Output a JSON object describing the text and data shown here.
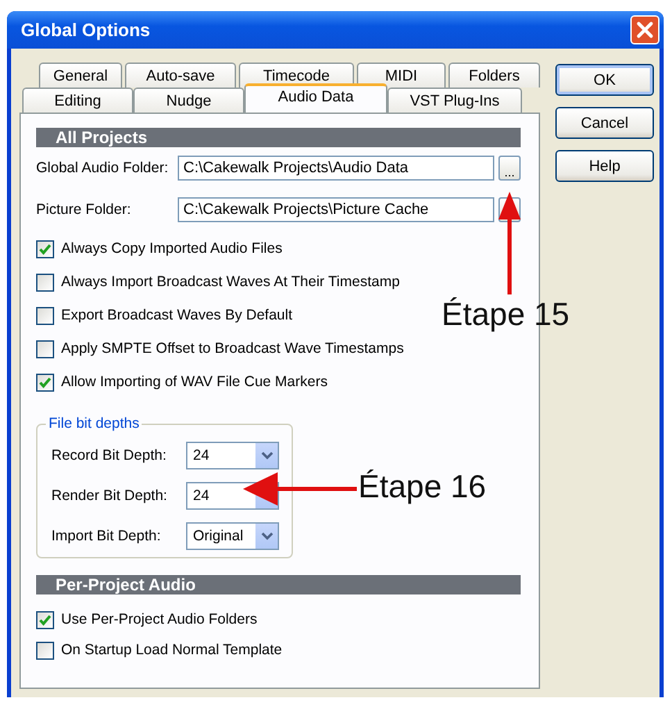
{
  "window": {
    "title": "Global Options"
  },
  "tab_rows": [
    {
      "tabs": [
        {
          "label": "General",
          "selected": false
        },
        {
          "label": "Auto-save",
          "selected": false
        },
        {
          "label": "Timecode",
          "selected": false
        },
        {
          "label": "MIDI",
          "selected": false
        },
        {
          "label": "Folders",
          "selected": false
        }
      ]
    },
    {
      "tabs": [
        {
          "label": "Editing",
          "selected": false
        },
        {
          "label": "Nudge",
          "selected": false
        },
        {
          "label": "Audio Data",
          "selected": true
        },
        {
          "label": "VST Plug-Ins",
          "selected": false
        }
      ]
    }
  ],
  "buttons": [
    {
      "label": "OK",
      "default": true
    },
    {
      "label": "Cancel",
      "default": false
    },
    {
      "label": "Help",
      "default": false
    }
  ],
  "sections": [
    {
      "title": "All Projects",
      "fields": [
        {
          "label": "Global Audio Folder:",
          "value": "C:\\Cakewalk Projects\\Audio Data",
          "button": "..."
        },
        {
          "label": "Picture Folder:",
          "value": "C:\\Cakewalk Projects\\Picture Cache"
        }
      ],
      "checkboxes": [
        {
          "label": "Always Copy Imported Audio Files",
          "checked": true
        },
        {
          "label": "Always Import Broadcast Waves At Their Timestamp",
          "checked": false
        },
        {
          "label": "Export Broadcast Waves By Default",
          "checked": false
        },
        {
          "label": "Apply SMPTE Offset to Broadcast Wave Timestamps",
          "checked": false
        },
        {
          "label": "Allow Importing of WAV File Cue Markers",
          "checked": true
        }
      ],
      "group": {
        "title": "File bit depths",
        "dropdowns": [
          {
            "label": "Record Bit Depth:",
            "value": "24"
          },
          {
            "label": "Render Bit Depth:",
            "value": "24"
          },
          {
            "label": "Import Bit Depth:",
            "value": "Original"
          }
        ]
      }
    },
    {
      "title": "Per-Project Audio",
      "checkboxes": [
        {
          "label": "Use Per-Project Audio Folders",
          "checked": true
        },
        {
          "label": "On Startup Load Normal Template",
          "checked": false
        }
      ]
    }
  ],
  "annotations": [
    {
      "text": "Étape 15",
      "kind": "up"
    },
    {
      "text": "Étape 16",
      "kind": "left"
    }
  ]
}
